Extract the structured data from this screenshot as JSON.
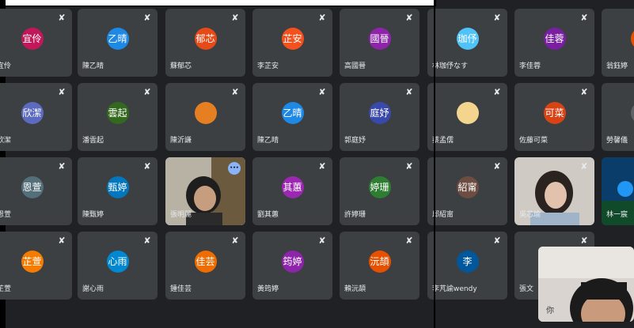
{
  "tiles": [
    {
      "label": "宜伶",
      "avatar": "宜伶",
      "color": "#c2185b",
      "muted": true
    },
    {
      "label": "陳乙晴",
      "avatar": "乙晴",
      "color": "#1e88e5",
      "muted": true
    },
    {
      "label": "蘇郁芯",
      "avatar": "郁芯",
      "color": "#e64a19",
      "muted": true
    },
    {
      "label": "李芷安",
      "avatar": "芷安",
      "color": "#f4511e",
      "muted": true
    },
    {
      "label": "高國晉",
      "avatar": "國晉",
      "color": "#8e24aa",
      "muted": true
    },
    {
      "label": "林珈伃なす",
      "avatar": "珈伃",
      "color": "#4fc3f7",
      "muted": true
    },
    {
      "label": "李佳蓉",
      "avatar": "佳蓉",
      "color": "#7b1fa2",
      "muted": true
    },
    {
      "label": "翁鈺婷",
      "avatar": "",
      "color": "#e65100",
      "muted": true
    },
    {
      "label": "欣潔",
      "avatar": "欣潔",
      "color": "#5c6bc0",
      "muted": true
    },
    {
      "label": "潘雲起",
      "avatar": "雲起",
      "color": "#33691e",
      "muted": true
    },
    {
      "label": "陳沂謙",
      "avatar": "",
      "color": "#e67e22",
      "muted": true
    },
    {
      "label": "陳乙晴",
      "avatar": "乙晴",
      "color": "#1e88e5",
      "muted": true
    },
    {
      "label": "郭庭妤",
      "avatar": "庭妤",
      "color": "#3949ab",
      "muted": true
    },
    {
      "label": "蔡孟儒",
      "avatar": "",
      "color": "#f4d58d",
      "muted": true
    },
    {
      "label": "佐藤可菜",
      "avatar": "可菜",
      "color": "#d84315",
      "muted": true
    },
    {
      "label": "勞馨儀",
      "avatar": "",
      "color": "#5f6368",
      "muted": true
    },
    {
      "label": "恩萱",
      "avatar": "恩萱",
      "color": "#546e7a",
      "muted": true
    },
    {
      "label": "陳甄婷",
      "avatar": "甄婷",
      "color": "#0277bd",
      "muted": true
    },
    {
      "label": "張明麗",
      "avatar": "",
      "color": "#3c4043",
      "muted": false
    },
    {
      "label": "劉其蕙",
      "avatar": "其蕙",
      "color": "#9c27b0",
      "muted": true
    },
    {
      "label": "許婷珊",
      "avatar": "婷珊",
      "color": "#2e7d32",
      "muted": true
    },
    {
      "label": "邱紹甯",
      "avatar": "紹甯",
      "color": "#6d4c41",
      "muted": true
    },
    {
      "label": "吳芯瑜",
      "avatar": "",
      "color": "#cfd8dc",
      "muted": true
    },
    {
      "label": "林一宸",
      "avatar": "",
      "color": "#0d47a1",
      "muted": true
    },
    {
      "label": "芷萱",
      "avatar": "芷萱",
      "color": "#f57c00",
      "muted": true
    },
    {
      "label": "謝心雨",
      "avatar": "心雨",
      "color": "#0288d1",
      "muted": true
    },
    {
      "label": "鍾佳芸",
      "avatar": "佳芸",
      "color": "#ef6c00",
      "muted": true
    },
    {
      "label": "黃筠婷",
      "avatar": "筠婷",
      "color": "#8e24aa",
      "muted": true
    },
    {
      "label": "賴沅頡",
      "avatar": "沅頡",
      "color": "#e65100",
      "muted": true
    },
    {
      "label": "李芃諭wendy",
      "avatar": "李",
      "color": "#01579b",
      "muted": true
    },
    {
      "label": "張文",
      "avatar": "",
      "color": "#3c4043",
      "muted": true
    }
  ],
  "self": {
    "label": "你"
  },
  "icons": {
    "mic_off": "mic-off-icon",
    "more": "more-options-icon"
  },
  "more_symbol": "•••"
}
